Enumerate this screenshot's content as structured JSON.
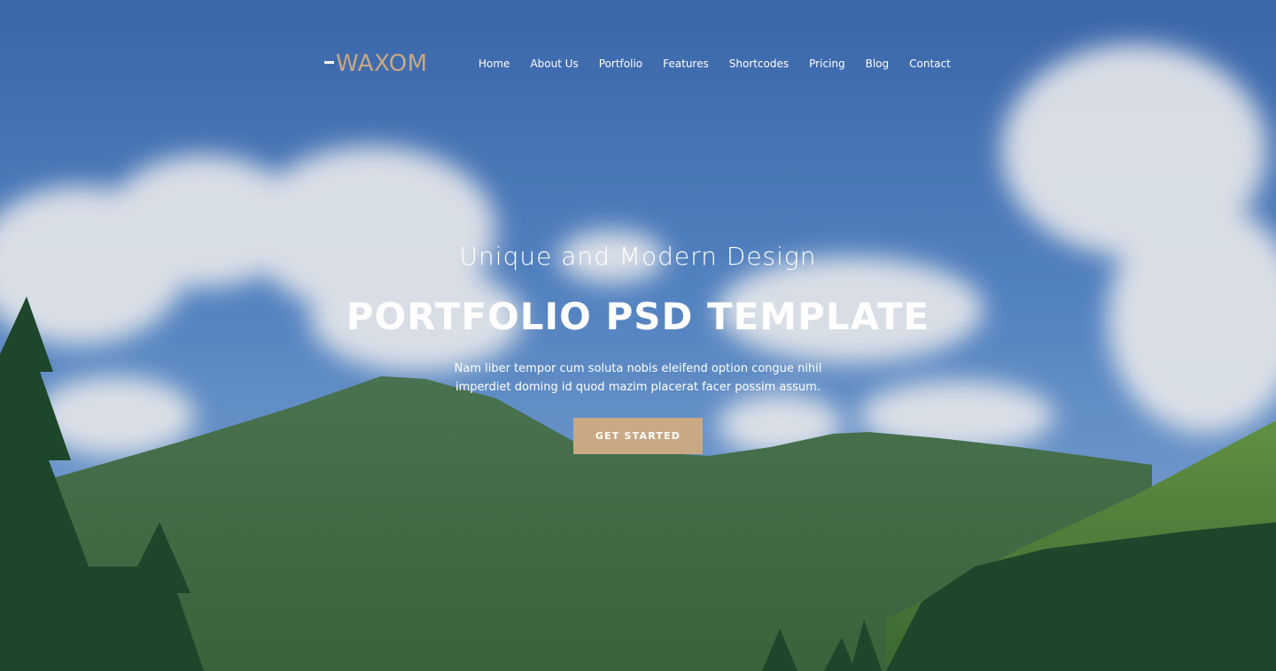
{
  "brand": {
    "logo_text": "WAXOM",
    "accent_color": "#c8a882"
  },
  "nav": {
    "items": [
      {
        "label": "Home"
      },
      {
        "label": "About Us"
      },
      {
        "label": "Portfolio"
      },
      {
        "label": "Features"
      },
      {
        "label": "Shortcodes"
      },
      {
        "label": "Pricing"
      },
      {
        "label": "Blog"
      },
      {
        "label": "Contact"
      }
    ]
  },
  "hero": {
    "subtitle": "Unique and Modern Design",
    "title": "PORTFOLIO PSD TEMPLATE",
    "description_line1": "Nam liber tempor cum soluta nobis eleifend option congue nihil",
    "description_line2": "imperdiet doming id quod mazim placerat facer possim assum.",
    "cta_label": "GET STARTED",
    "background_image": "mountain-landscape-with-clouds"
  }
}
